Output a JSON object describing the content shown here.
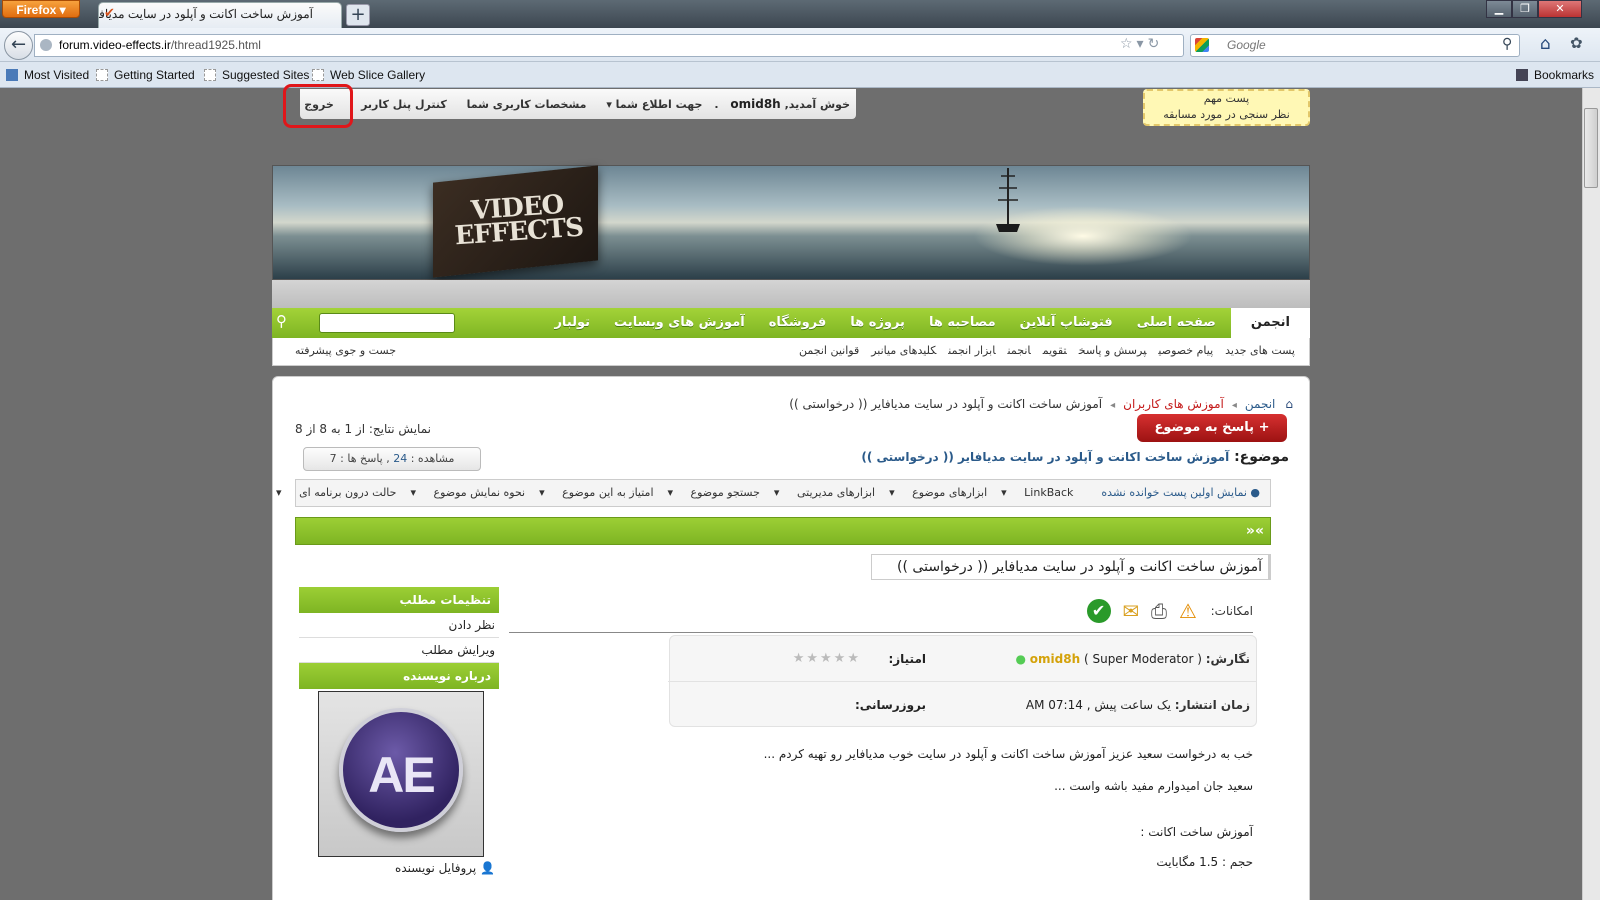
{
  "browser": {
    "app_button": "Firefox",
    "tab_title": "آموزش ساخت اکانت و آپلود در سایت مدیافا...",
    "new_tab": "+",
    "url_domain": "forum.video-effects.ir",
    "url_path": "/thread1925.html",
    "search_placeholder": "Google",
    "bookmarks": [
      "Most Visited",
      "Getting Started",
      "Suggested Sites",
      "Web Slice Gallery"
    ],
    "bookmarks_menu": "Bookmarks"
  },
  "notice": {
    "line1": "پست مهم",
    "line2": "نظر سنجی در مورد مسابقه"
  },
  "userbar": {
    "welcome": "خوش آمدید,",
    "username": "omid8h",
    "notifications": "جهت اطلاع شما",
    "profile": "مشخصات کاربری شما",
    "control_panel": "کنترل پنل کاربر",
    "logout": "خروج"
  },
  "banner": {
    "logo_line1": "VIDEO",
    "logo_line2": "EFFECTS"
  },
  "main_nav": {
    "tabs": [
      "انجمن",
      "صفحه اصلی",
      "فتوشاپ آنلاین",
      "مصاحبه ها",
      "پروژه ها",
      "فروشگاه",
      "آموزش های وبسایت",
      "تولبار"
    ]
  },
  "sub_nav": {
    "items": [
      "پست های جدید",
      "پیام خصوصی",
      "پرسش و پاسخ",
      "تقویم",
      "انجمن",
      "ابزار انجمن",
      "کلیدهای میانبر",
      "قوانین انجمن"
    ],
    "advanced_search": "جست و جوی پیشرفته"
  },
  "breadcrumb": {
    "home": "انجمن",
    "section": "آموزش های کاربران",
    "current": "آموزش ساخت اکانت و آپلود در سایت مدیافایر (( درخواستی ))"
  },
  "thread": {
    "results": "نمایش نتایج: از 1 به 8 از 8",
    "reply_button": "+ پاسخ به موضوع",
    "topic_label": "موضوع:",
    "topic_title": "آموزش ساخت اکانت و آپلود در سایت مدیافایر (( درخواستی ))",
    "views_label": "مشاهده :",
    "views": "24",
    "replies_label": ", پاسخ ها :",
    "replies": "7"
  },
  "toolbar": {
    "first_unread": "نمایش اولین پست خوانده نشده",
    "linkback": "LinkBack",
    "thread_tools": "ابزارهای موضوع",
    "admin_tools": "ابزارهای مدیریتی",
    "search_thread": "جستجو موضوع",
    "rate_thread": "امتیاز به این موضوع",
    "display_mode": "نحوه نمایش موضوع",
    "inline_mode": "حالت درون برنامه ای"
  },
  "post": {
    "nav_arrows": "»«",
    "title": "آموزش ساخت اکانت و آپلود در سایت مدیافایر (( درخواستی ))",
    "options_label": "امکانات:",
    "author_label": "نگارش:",
    "author": "omid8h",
    "author_role": "( Super Moderator )",
    "rating_label": "امتیاز:",
    "stars": "★★★★★",
    "date_label": "زمان انتشار:",
    "date": "یک ساعت پیش , 07:14 AM",
    "updated_label": "بروزرسانی:",
    "body": [
      "خب به درخواست سعید عزیز آموزش ساخت اکانت و آپلود در سایت خوب مدیافایر رو تهیه کردم ...",
      "سعید جان امیدوارم مفید باشه واست ...",
      "آموزش ساخت اکانت :",
      "حجم : 1.5 مگابایت"
    ]
  },
  "sidebar": {
    "post_settings": "تنظیمات مطلب",
    "comment": "نظر دادن",
    "edit": "ویرایش مطلب",
    "about_author": "درباره نویسنده",
    "avatar_text": "AE",
    "author_profile": "پروفایل نویسنده"
  }
}
